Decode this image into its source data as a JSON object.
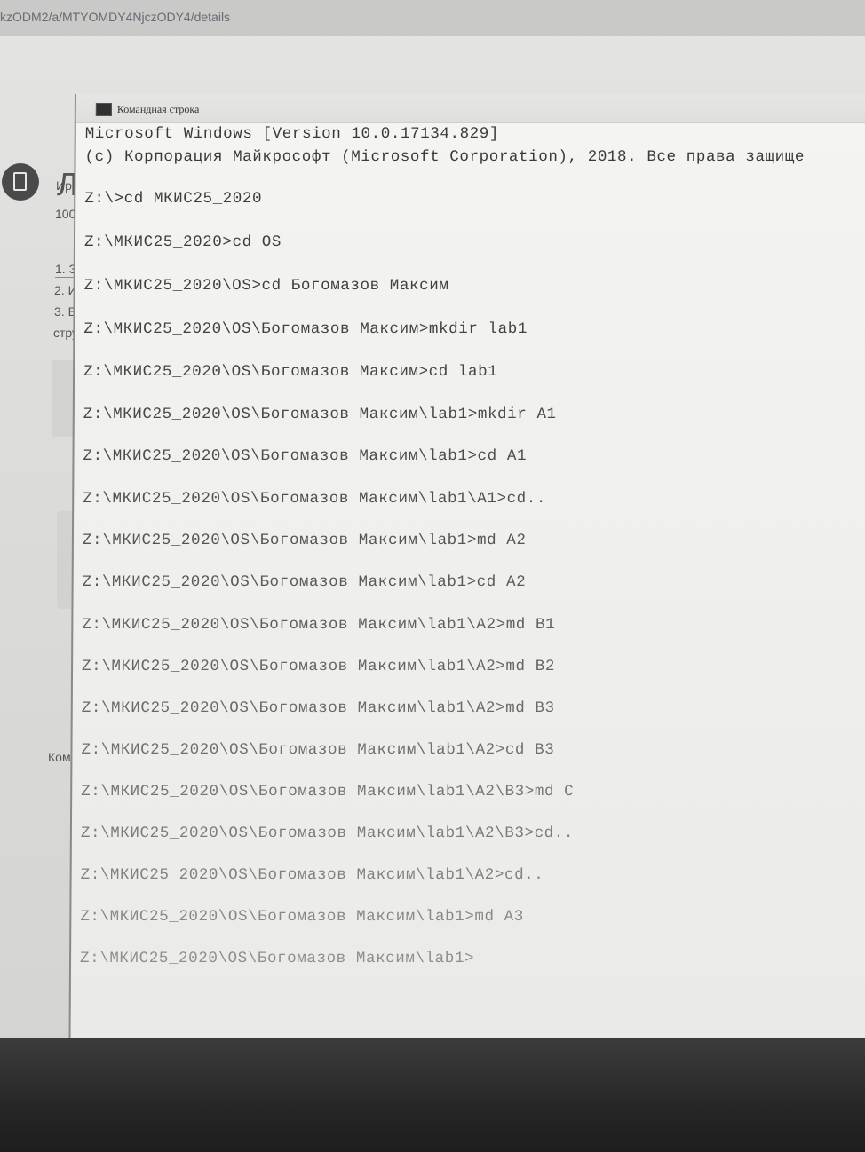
{
  "browser": {
    "url": "kzODM2/a/MTYOMDY4NjczODY4/details"
  },
  "webpage": {
    "heading": "Л",
    "author": "Ири",
    "points": "100",
    "list_items": [
      "1. З",
      "2. И",
      "3. В",
      "стру"
    ],
    "comment_label": "Ком"
  },
  "cmd_window": {
    "title": "Командная строка",
    "icon": "cmd-console-icon",
    "header_lines": [
      "Microsoft Windows [Version 10.0.17134.829]",
      "(c) Корпорация Майкрософт (Microsoft Corporation), 2018. Все права защище"
    ],
    "commands": [
      "Z:\\>cd МКИС25_2020",
      "Z:\\МКИС25_2020>cd OS",
      "Z:\\МКИС25_2020\\OS>cd Богомазов Максим",
      "Z:\\МКИС25_2020\\OS\\Богомазов Максим>mkdir lab1",
      "Z:\\МКИС25_2020\\OS\\Богомазов Максим>cd lab1",
      "Z:\\МКИС25_2020\\OS\\Богомазов Максим\\lab1>mkdir A1",
      "Z:\\МКИС25_2020\\OS\\Богомазов Максим\\lab1>cd A1",
      "Z:\\МКИС25_2020\\OS\\Богомазов Максим\\lab1\\A1>cd..",
      "Z:\\МКИС25_2020\\OS\\Богомазов Максим\\lab1>md A2",
      "Z:\\МКИС25_2020\\OS\\Богомазов Максим\\lab1>cd A2",
      "Z:\\МКИС25_2020\\OS\\Богомазов Максим\\lab1\\A2>md B1",
      "Z:\\МКИС25_2020\\OS\\Богомазов Максим\\lab1\\A2>md B2",
      "Z:\\МКИС25_2020\\OS\\Богомазов Максим\\lab1\\A2>md B3",
      "Z:\\МКИС25_2020\\OS\\Богомазов Максим\\lab1\\A2>cd B3",
      "Z:\\МКИС25_2020\\OS\\Богомазов Максим\\lab1\\A2\\B3>md C",
      "Z:\\МКИС25_2020\\OS\\Богомазов Максим\\lab1\\A2\\B3>cd..",
      "Z:\\МКИС25_2020\\OS\\Богомазов Максим\\lab1\\A2>cd..",
      "Z:\\МКИС25_2020\\OS\\Богомазов Максим\\lab1>md A3",
      "Z:\\МКИС25_2020\\OS\\Богомазов Максим\\lab1>"
    ]
  }
}
